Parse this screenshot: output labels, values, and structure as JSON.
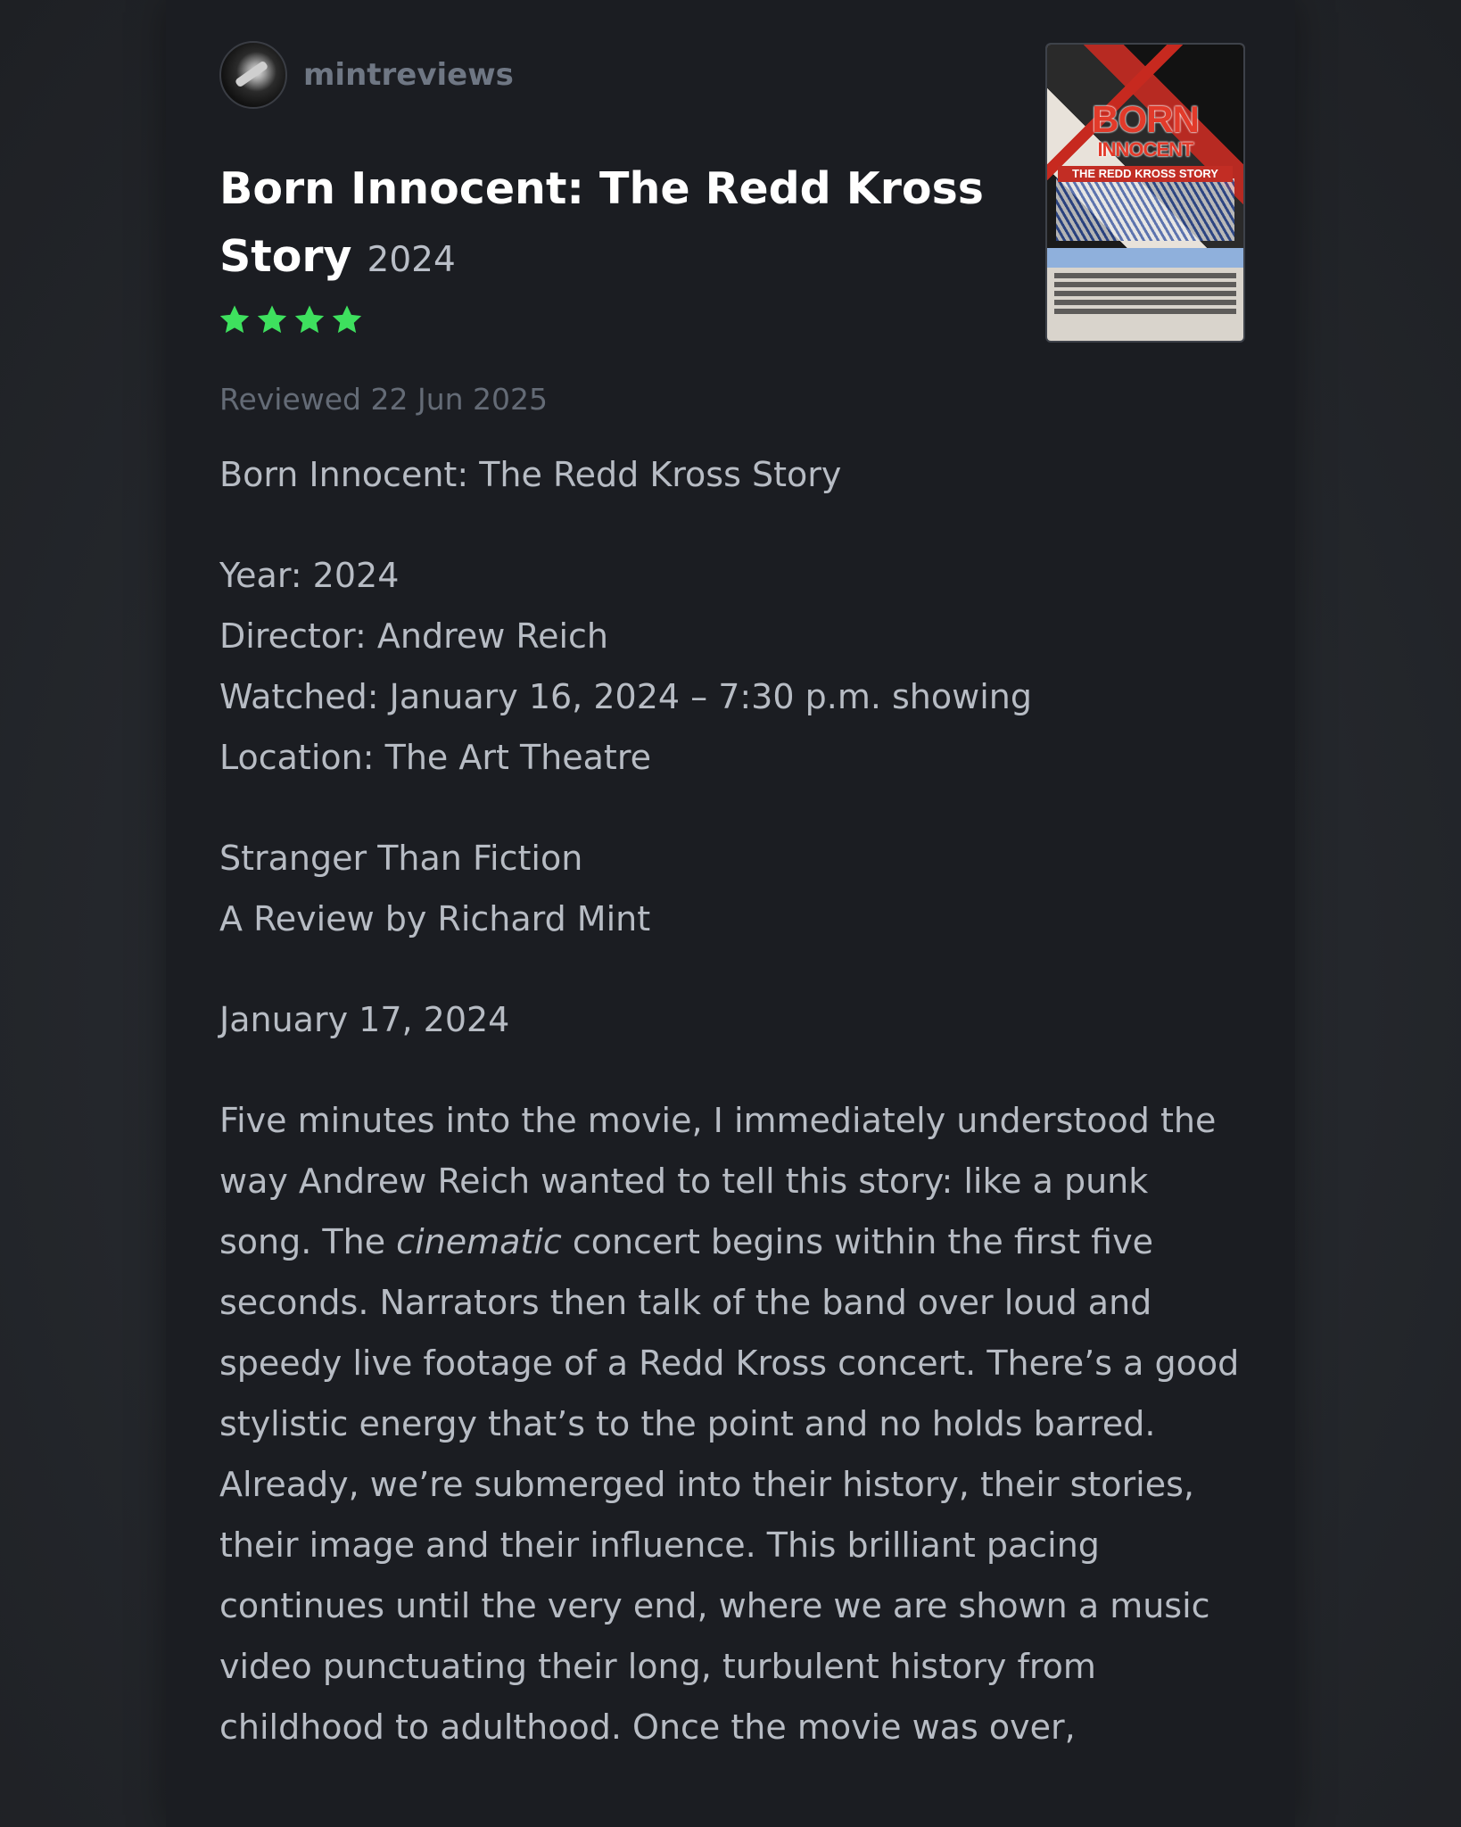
{
  "author": {
    "username": "mintreviews"
  },
  "film": {
    "title": "Born Innocent: The Redd Kross Story",
    "year": "2024",
    "rating_stars": 4,
    "star_color": "#3ee05e"
  },
  "poster": {
    "title_line1": "BORN",
    "title_line2": "INNOCENT",
    "subtitle": "THE REDD KROSS STORY"
  },
  "review": {
    "reviewed_date": "Reviewed 22 Jun 2025",
    "heading": "Born Innocent: The Redd Kross Story",
    "details": [
      "Year: 2024",
      "Director: Andrew Reich",
      "Watched: January 16, 2024 – 7:30 p.m. showing",
      "Location: The Art Theatre"
    ],
    "byline_title": "Stranger Than Fiction",
    "byline_author": "A Review by Richard Mint",
    "date": "January 17, 2024",
    "paragraph_part1": "Five minutes into the movie, I immediately understood the way Andrew Reich wanted to tell this story: like a punk song. The ",
    "paragraph_emphasis": "cinematic",
    "paragraph_part2": " concert begins within the first five seconds. Narrators then talk of the band over loud and speedy live footage of a Redd Kross concert. There’s a good stylistic energy that’s to the point and no holds barred. Already, we’re submerged into their history, their stories, their image and their influence. This brilliant pacing continues until the very end, where we are shown a music video punctuating their long, turbulent history from childhood to adulthood. Once the movie was over,"
  }
}
